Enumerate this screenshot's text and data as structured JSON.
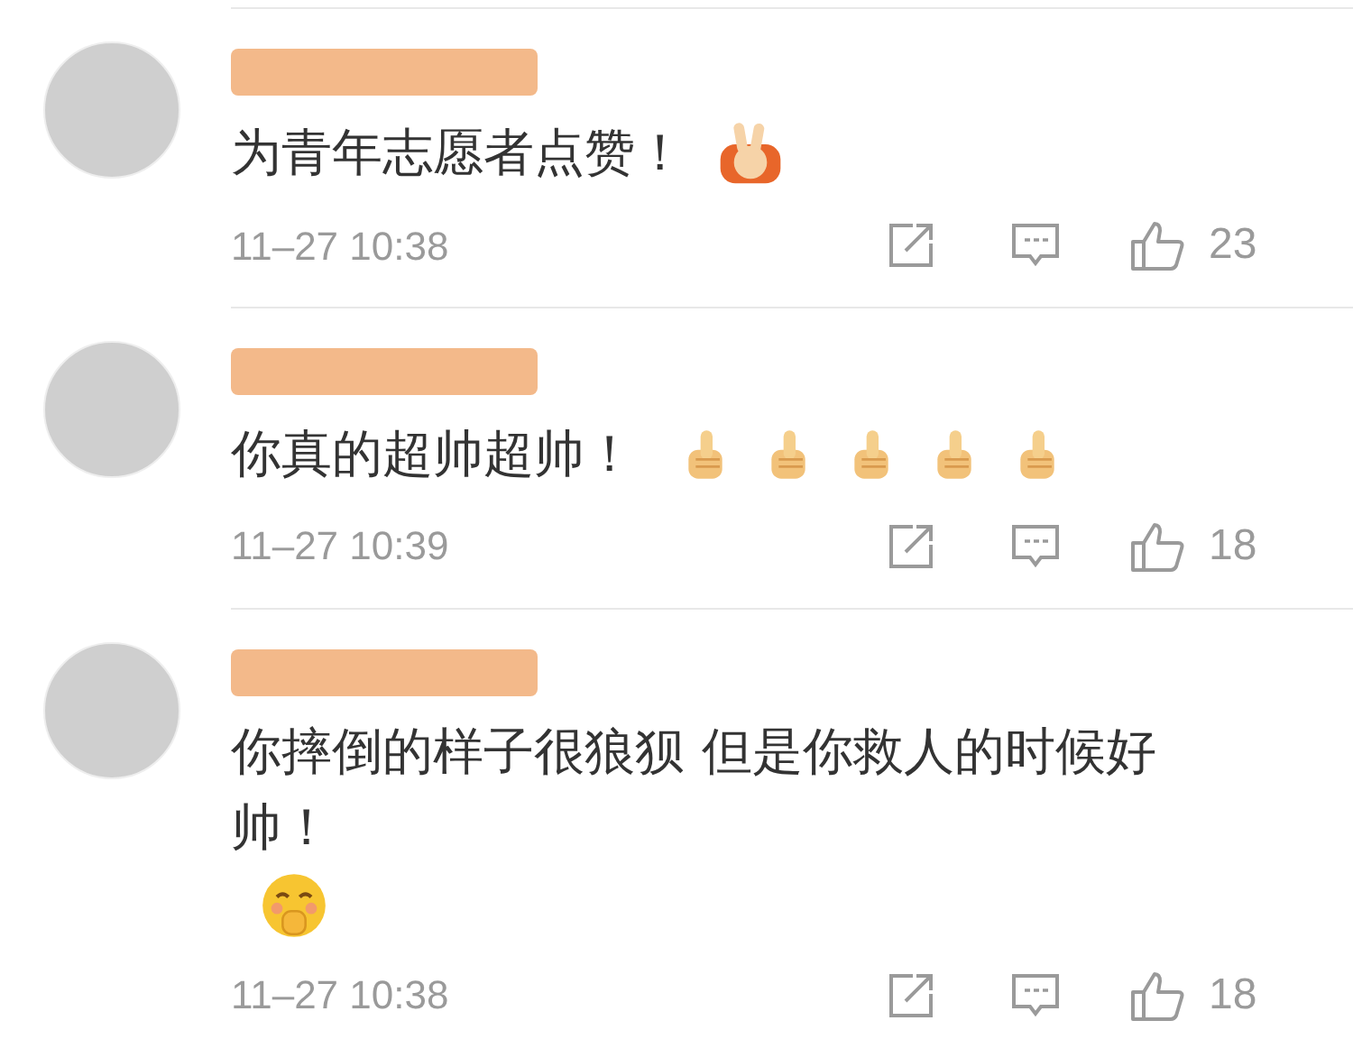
{
  "comments": [
    {
      "text": "为青年志愿者点赞！",
      "kind": "victory",
      "time": "11–27 10:38",
      "likes": "23"
    },
    {
      "text": "你真的超帅超帅！",
      "kind": "thumbs",
      "time": "11–27 10:39",
      "likes": "18"
    },
    {
      "text": "你摔倒的样子很狼狈 但是你救人的时候好帅！",
      "kind": "face",
      "time": "11–27 10:38",
      "likes": "18"
    }
  ]
}
